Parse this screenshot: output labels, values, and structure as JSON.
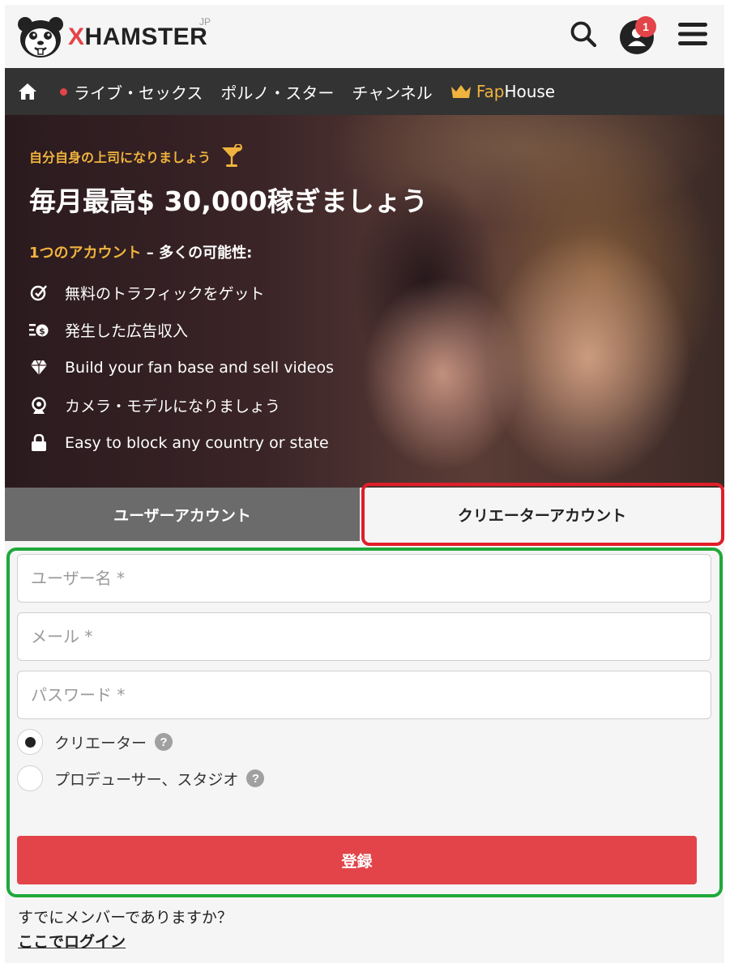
{
  "header": {
    "logo_text_x": "X",
    "logo_text_rest": "HAMSTER",
    "region": "JP",
    "notification_count": "1",
    "icons": [
      "hamster-logo-icon",
      "search-icon",
      "user-icon",
      "menu-icon"
    ]
  },
  "nav": {
    "items": [
      {
        "label": "ライブ・セックス",
        "icon": "live-dot"
      },
      {
        "label": "ポルノ・スター"
      },
      {
        "label": "チャンネル"
      }
    ],
    "fap_prefix": "Fap",
    "fap_suffix": "House"
  },
  "hero": {
    "tagline": "自分自身の上司になりましょう",
    "title": "毎月最高$ 30,000稼ぎましょう",
    "subtitle_accent": "1つのアカウント",
    "subtitle_rest": " – 多くの可能性:",
    "features": [
      {
        "label": "無料のトラフィックをゲット",
        "icon": "traffic-icon"
      },
      {
        "label": "発生した広告収入",
        "icon": "ad-revenue-icon"
      },
      {
        "label": "Build your fan base and sell videos",
        "icon": "diamond-icon"
      },
      {
        "label": "カメラ・モデルになりましょう",
        "icon": "webcam-icon"
      },
      {
        "label": "Easy to block any country or state",
        "icon": "lock-icon"
      }
    ]
  },
  "tabs": {
    "user": "ユーザーアカウント",
    "creator": "クリエーターアカウント",
    "active": "creator"
  },
  "form": {
    "username_placeholder": "ユーザー名 *",
    "email_placeholder": "メール *",
    "password_placeholder": "パスワード *",
    "radio_creator": "クリエーター",
    "radio_producer": "プロデューサー、スタジオ",
    "help_symbol": "?",
    "selected": "creator",
    "submit_label": "登録"
  },
  "footer": {
    "member_text": "すでにメンバーでありますか？",
    "login_link": "ここでログイン"
  },
  "colors": {
    "accent_red": "#e34449",
    "accent_gold": "#f0b33e",
    "nav_bg": "#333333",
    "highlight_red": "#e01e2a",
    "highlight_green": "#1fa83a"
  }
}
